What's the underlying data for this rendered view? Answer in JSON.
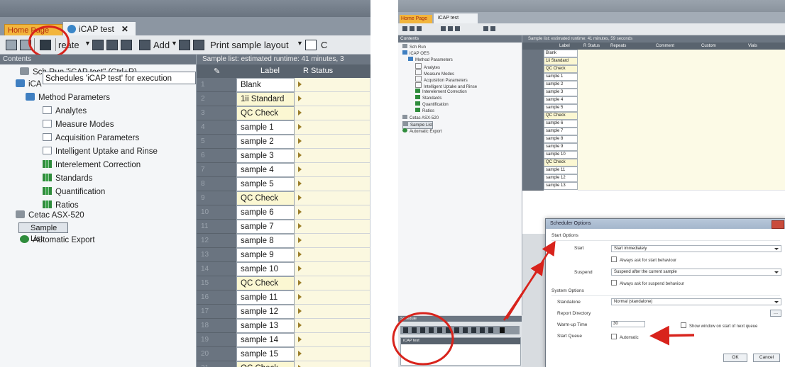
{
  "left": {
    "tabs": {
      "home": "Home Page",
      "icap": "iCAP test"
    },
    "toolbar": {
      "create": "reate",
      "add": "Add",
      "print": "Print sample layout",
      "last": "C"
    },
    "tree": {
      "header": "Contents",
      "items": [
        "Sch Run \"iCAP test\" (Ctrl+R)",
        "iCA",
        "Method Parameters",
        "Analytes",
        "Measure Modes",
        "Acquisition Parameters",
        "Intelligent Uptake and Rinse",
        "Interelement Correction",
        "Standards",
        "Quantification",
        "Ratios",
        "Cetac ASX-520",
        "Sample List",
        "Automatic Export"
      ],
      "tooltip": "Schedules 'iCAP test' for execution"
    },
    "grid": {
      "header": "Sample list: estimated runtime: 41 minutes, 3",
      "col_label": "Label",
      "col_status": "R Status",
      "rows": [
        {
          "n": "1",
          "label": "Blank",
          "qc": false
        },
        {
          "n": "2",
          "label": "1ii Standard",
          "qc": true
        },
        {
          "n": "3",
          "label": "QC Check",
          "qc": true
        },
        {
          "n": "4",
          "label": "sample 1",
          "qc": false
        },
        {
          "n": "5",
          "label": "sample 2",
          "qc": false
        },
        {
          "n": "6",
          "label": "sample 3",
          "qc": false
        },
        {
          "n": "7",
          "label": "sample 4",
          "qc": false
        },
        {
          "n": "8",
          "label": "sample 5",
          "qc": false
        },
        {
          "n": "9",
          "label": "QC Check",
          "qc": true
        },
        {
          "n": "10",
          "label": "sample 6",
          "qc": false
        },
        {
          "n": "11",
          "label": "sample 7",
          "qc": false
        },
        {
          "n": "12",
          "label": "sample 8",
          "qc": false
        },
        {
          "n": "13",
          "label": "sample 9",
          "qc": false
        },
        {
          "n": "14",
          "label": "sample 10",
          "qc": false
        },
        {
          "n": "15",
          "label": "QC Check",
          "qc": true
        },
        {
          "n": "16",
          "label": "sample 11",
          "qc": false
        },
        {
          "n": "17",
          "label": "sample 12",
          "qc": false
        },
        {
          "n": "18",
          "label": "sample 13",
          "qc": false
        },
        {
          "n": "19",
          "label": "sample 14",
          "qc": false
        },
        {
          "n": "20",
          "label": "sample 15",
          "qc": false
        },
        {
          "n": "21",
          "label": "QC Check",
          "qc": true
        }
      ]
    }
  },
  "right": {
    "tabs": {
      "home": "Home Page",
      "icap": "iCAP test"
    },
    "tree_header": "Contents",
    "tree_items": [
      "Sch Run",
      "iCAP OES",
      "Method Parameters",
      "Analytes",
      "Measure Modes",
      "Acquisition Parameters",
      "Intelligent Uptake and Rinse",
      "Interelement Correction",
      "Standards",
      "Quantification",
      "Ratios",
      "Cetac ASX-520",
      "Sample List",
      "Automatic Export"
    ],
    "grid_header": "Sample list: estimated runtime: 41 minutes, 59 seconds",
    "grid_cols": [
      "Label",
      "R Status",
      "Repeats",
      "Comment",
      "Custom",
      "Vials"
    ],
    "rows": [
      {
        "label": "Blank",
        "qc": false
      },
      {
        "label": "1ii Standard",
        "qc": true
      },
      {
        "label": "QC Check",
        "qc": true
      },
      {
        "label": "sample 1",
        "qc": false
      },
      {
        "label": "sample 2",
        "qc": false
      },
      {
        "label": "sample 3",
        "qc": false
      },
      {
        "label": "sample 4",
        "qc": false
      },
      {
        "label": "sample 5",
        "qc": false
      },
      {
        "label": "QC Check",
        "qc": true
      },
      {
        "label": "sample 6",
        "qc": false
      },
      {
        "label": "sample 7",
        "qc": false
      },
      {
        "label": "sample 8",
        "qc": false
      },
      {
        "label": "sample 9",
        "qc": false
      },
      {
        "label": "sample 10",
        "qc": false
      },
      {
        "label": "QC Check",
        "qc": true
      },
      {
        "label": "sample 11",
        "qc": false
      },
      {
        "label": "sample 12",
        "qc": false
      },
      {
        "label": "sample 13",
        "qc": false
      }
    ],
    "schedule_header": "Schedule",
    "schedule_row": "iCAP test",
    "dialog": {
      "title": "Scheduler Options",
      "start_section": "Start Options",
      "start_label": "Start",
      "start_value": "Start immediately",
      "start_check": "Always ask for start behaviour",
      "suspend_label": "Suspend",
      "suspend_value": "Suspend after the current sample",
      "suspend_check": "Always ask for suspend behaviour",
      "system_section": "System Options",
      "standalone_label": "Standalone",
      "standalone_value": "Normal (standalone)",
      "report_label": "Report Directory",
      "warmup_label": "Warm-up Time",
      "warmup_value": "30",
      "warmup_check": "Show window on start of next queue",
      "startqueue_label": "Start Queue",
      "startqueue_check": "Automatic",
      "ok": "OK",
      "cancel": "Cancel"
    }
  },
  "colors": {
    "highlight_red": "#d8231c",
    "home_tab": "#f2b53c",
    "qc_row": "#fbf7d2"
  }
}
